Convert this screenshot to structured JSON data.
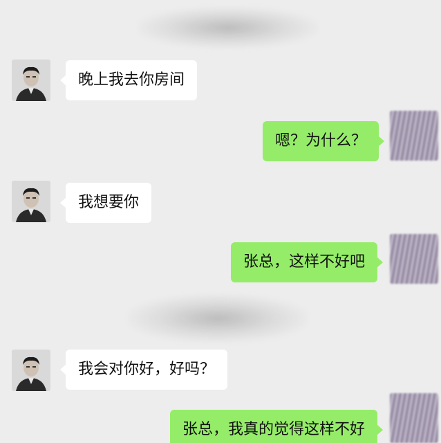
{
  "conversation": {
    "messages": [
      {
        "sender": "contact",
        "text": "晚上我去你房间"
      },
      {
        "sender": "self",
        "text": "嗯？为什么？"
      },
      {
        "sender": "contact",
        "text": "我想要你"
      },
      {
        "sender": "self",
        "text": "张总，这样不好吧"
      },
      {
        "sender": "contact",
        "text": "我会对你好，好吗？"
      },
      {
        "sender": "self",
        "text": "张总，我真的觉得这样不好"
      }
    ]
  },
  "colors": {
    "background": "#ededed",
    "incoming_bubble": "#ffffff",
    "outgoing_bubble": "#95ec69",
    "text": "#111111"
  }
}
